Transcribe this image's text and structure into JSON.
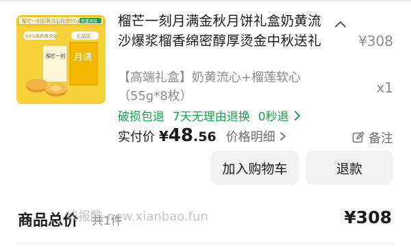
{
  "product": {
    "title": "榴芒一刻月满金秋月饼礼盒奶黄流沙爆浆榴香绵密醇厚烫金中秋送礼",
    "spec": "【高端礼盒】奶黄流心+榴莲软心（55g*8枚）",
    "price": "¥308",
    "quantity": "x1",
    "thumbnail": {
      "banner_text": "榴芒一刻奶黄流心月饼55g*8枚",
      "banner_badge": "双重风味",
      "tag_percent": "50%真奶黄含量",
      "tag_gift": "礼品袋",
      "box_text": "榴芒一刻",
      "bag_text": "月满"
    }
  },
  "services": [
    "破损包退",
    "7天无理由退换",
    "0秒退"
  ],
  "payment": {
    "label": "实付价",
    "currency": "¥",
    "amount_int": "48",
    "amount_dec": ".56",
    "detail_label": "价格明细"
  },
  "note_label": "备注",
  "actions": {
    "add_to_cart": "加入购物车",
    "refund": "退款"
  },
  "summary": {
    "label": "商品总价",
    "count": "共1件",
    "amount": "¥308"
  },
  "watermark": "线报酷-new.xianbao.fun",
  "colors": {
    "service_green": "#1aa34a",
    "thumbnail_yellow": "#f5c51c",
    "button_bg": "#f2f2f2"
  },
  "icons": [
    "chevron-up-icon",
    "chevron-right-icon",
    "edit-note-icon"
  ]
}
